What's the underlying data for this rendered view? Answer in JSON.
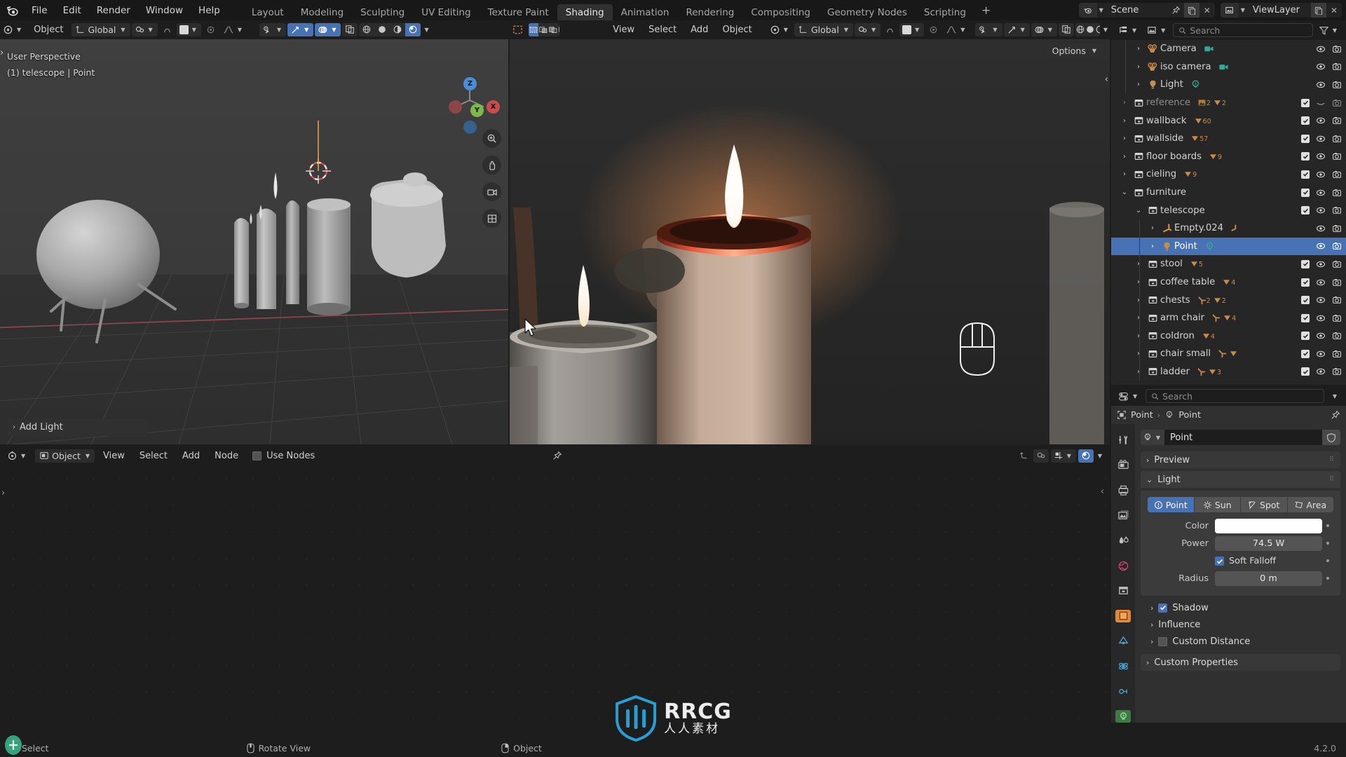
{
  "app": {
    "name": "Blender",
    "version": "4.2.0"
  },
  "topbar": {
    "menus": [
      "File",
      "Edit",
      "Render",
      "Window",
      "Help"
    ],
    "workspace_tabs": [
      {
        "label": "Layout",
        "active": false
      },
      {
        "label": "Modeling",
        "active": false
      },
      {
        "label": "Sculpting",
        "active": false
      },
      {
        "label": "UV Editing",
        "active": false
      },
      {
        "label": "Texture Paint",
        "active": false
      },
      {
        "label": "Shading",
        "active": true
      },
      {
        "label": "Animation",
        "active": false
      },
      {
        "label": "Rendering",
        "active": false
      },
      {
        "label": "Compositing",
        "active": false
      },
      {
        "label": "Geometry Nodes",
        "active": false
      },
      {
        "label": "Scripting",
        "active": false
      }
    ],
    "add_workspace": "+",
    "scene_name": "Scene",
    "viewlayer_name": "ViewLayer"
  },
  "viewport_left": {
    "mode": "Object",
    "transform_orientation": "Global",
    "overlay_text_line1": "User Perspective",
    "overlay_text_line2": "(1) telescope | Point",
    "operator_panel": "Add Light",
    "gizmo_axes": [
      "Z",
      "Y",
      "X"
    ]
  },
  "viewport_right": {
    "menus": [
      "View",
      "Select",
      "Add",
      "Object"
    ],
    "mode": "Object",
    "transform_orientation": "Global",
    "options_label": "Options"
  },
  "node_editor": {
    "mode": "Object",
    "menus": [
      "View",
      "Select",
      "Add",
      "Node"
    ],
    "use_nodes_label": "Use Nodes"
  },
  "outliner": {
    "search_placeholder": "Search",
    "items": [
      {
        "name": "Camera",
        "indent": 1,
        "icon": "camera-icon",
        "disclosure": "closed",
        "dim": false,
        "selected": false,
        "badges": [
          {
            "type": "camera-data",
            "count": ""
          }
        ],
        "checkbox": false,
        "eye": "open",
        "render": true
      },
      {
        "name": "iso camera",
        "indent": 1,
        "icon": "camera-icon",
        "disclosure": "closed",
        "dim": false,
        "selected": false,
        "badges": [
          {
            "type": "camera-data",
            "count": ""
          }
        ],
        "checkbox": false,
        "eye": "open",
        "render": true
      },
      {
        "name": "Light",
        "indent": 1,
        "icon": "light-icon",
        "disclosure": "closed",
        "dim": false,
        "selected": false,
        "badges": [
          {
            "type": "light-data",
            "count": ""
          }
        ],
        "checkbox": false,
        "eye": "open",
        "render": true
      },
      {
        "name": "reference",
        "indent": 0,
        "icon": "collection-icon",
        "disclosure": "closed",
        "dim": true,
        "selected": false,
        "badges": [
          {
            "type": "image",
            "count": "2"
          },
          {
            "type": "mesh",
            "count": "2"
          }
        ],
        "checkbox": true,
        "eye": "closed",
        "render": true
      },
      {
        "name": "wallback",
        "indent": 0,
        "icon": "collection-icon",
        "disclosure": "closed",
        "dim": false,
        "selected": false,
        "badges": [
          {
            "type": "mesh",
            "count": "60"
          }
        ],
        "checkbox": true,
        "eye": "open",
        "render": true
      },
      {
        "name": "wallside",
        "indent": 0,
        "icon": "collection-icon",
        "disclosure": "closed",
        "dim": false,
        "selected": false,
        "badges": [
          {
            "type": "mesh",
            "count": "57"
          }
        ],
        "checkbox": true,
        "eye": "open",
        "render": true
      },
      {
        "name": "floor boards",
        "indent": 0,
        "icon": "collection-icon",
        "disclosure": "closed",
        "dim": false,
        "selected": false,
        "badges": [
          {
            "type": "mesh",
            "count": "9"
          }
        ],
        "checkbox": true,
        "eye": "open",
        "render": true
      },
      {
        "name": "cieling",
        "indent": 0,
        "icon": "collection-icon",
        "disclosure": "closed",
        "dim": false,
        "selected": false,
        "badges": [
          {
            "type": "mesh",
            "count": "9"
          }
        ],
        "checkbox": true,
        "eye": "open",
        "render": true
      },
      {
        "name": "furniture",
        "indent": 0,
        "icon": "collection-icon",
        "disclosure": "open",
        "dim": false,
        "selected": false,
        "badges": [],
        "checkbox": true,
        "eye": "open",
        "render": true
      },
      {
        "name": "telescope",
        "indent": 1,
        "icon": "collection-icon",
        "disclosure": "open",
        "dim": false,
        "selected": false,
        "badges": [],
        "checkbox": true,
        "eye": "open",
        "render": true
      },
      {
        "name": "Empty.024",
        "indent": 2,
        "icon": "empty-icon",
        "disclosure": "closed",
        "dim": false,
        "selected": false,
        "badges": [
          {
            "type": "empty-data",
            "count": ""
          }
        ],
        "checkbox": false,
        "eye": "open",
        "render": true
      },
      {
        "name": "Point",
        "indent": 2,
        "icon": "light-icon",
        "disclosure": "closed",
        "dim": false,
        "selected": true,
        "badges": [
          {
            "type": "light-data",
            "count": ""
          }
        ],
        "checkbox": false,
        "eye": "open",
        "render": true
      },
      {
        "name": "stool",
        "indent": 1,
        "icon": "collection-icon",
        "disclosure": "closed",
        "dim": false,
        "selected": false,
        "badges": [
          {
            "type": "mesh",
            "count": "5"
          }
        ],
        "checkbox": true,
        "eye": "open",
        "render": true
      },
      {
        "name": "coffee table",
        "indent": 1,
        "icon": "collection-icon",
        "disclosure": "closed",
        "dim": false,
        "selected": false,
        "badges": [
          {
            "type": "mesh",
            "count": "4"
          }
        ],
        "checkbox": true,
        "eye": "open",
        "render": true
      },
      {
        "name": "chests",
        "indent": 1,
        "icon": "collection-icon",
        "disclosure": "closed",
        "dim": false,
        "selected": false,
        "badges": [
          {
            "type": "empty",
            "count": "2"
          },
          {
            "type": "mesh",
            "count": "2"
          }
        ],
        "checkbox": true,
        "eye": "open",
        "render": true
      },
      {
        "name": "arm chair",
        "indent": 1,
        "icon": "collection-icon",
        "disclosure": "closed",
        "dim": false,
        "selected": false,
        "badges": [
          {
            "type": "empty",
            "count": ""
          },
          {
            "type": "mesh",
            "count": "4"
          }
        ],
        "checkbox": true,
        "eye": "open",
        "render": true
      },
      {
        "name": "coldron",
        "indent": 1,
        "icon": "collection-icon",
        "disclosure": "closed",
        "dim": false,
        "selected": false,
        "badges": [
          {
            "type": "mesh",
            "count": "4"
          }
        ],
        "checkbox": true,
        "eye": "open",
        "render": true
      },
      {
        "name": "chair small",
        "indent": 1,
        "icon": "collection-icon",
        "disclosure": "closed",
        "dim": false,
        "selected": false,
        "badges": [
          {
            "type": "empty",
            "count": ""
          },
          {
            "type": "mesh",
            "count": ""
          }
        ],
        "checkbox": true,
        "eye": "open",
        "render": true
      },
      {
        "name": "ladder",
        "indent": 1,
        "icon": "collection-icon",
        "disclosure": "closed",
        "dim": false,
        "selected": false,
        "badges": [
          {
            "type": "empty",
            "count": ""
          },
          {
            "type": "mesh",
            "count": "3"
          }
        ],
        "checkbox": true,
        "eye": "open",
        "render": true
      }
    ]
  },
  "properties": {
    "search_placeholder": "Search",
    "breadcrumb": [
      "Point",
      "Point"
    ],
    "datablock_name": "Point",
    "panels": {
      "preview": {
        "label": "Preview",
        "open": false
      },
      "light": {
        "label": "Light",
        "open": true
      },
      "shadow": {
        "label": "Shadow",
        "open": false,
        "checked": true
      },
      "influence": {
        "label": "Influence",
        "open": false
      },
      "custom_distance": {
        "label": "Custom Distance",
        "open": false,
        "checked": false
      },
      "custom_properties": {
        "label": "Custom Properties",
        "open": false
      }
    },
    "light_types": [
      {
        "label": "Point",
        "active": true
      },
      {
        "label": "Sun",
        "active": false
      },
      {
        "label": "Spot",
        "active": false
      },
      {
        "label": "Area",
        "active": false
      }
    ],
    "fields": {
      "color_label": "Color",
      "color_value": "#ffffff",
      "power_label": "Power",
      "power_value": "74.5 W",
      "soft_falloff_label": "Soft Falloff",
      "soft_falloff_checked": true,
      "radius_label": "Radius",
      "radius_value": "0 m"
    }
  },
  "statusbar": {
    "entries": [
      {
        "icon": "mouse-left-icon",
        "label": "Select"
      },
      {
        "icon": "mouse-middle-icon",
        "label": "Rotate View"
      },
      {
        "icon": "mouse-right-icon",
        "label": "Object"
      }
    ],
    "version": "4.2.0"
  },
  "watermark": {
    "line1": "RRCG",
    "line2": "人人素材"
  },
  "colors": {
    "accent_blue": "#4772b3",
    "outliner_bg": "#262626",
    "properties_bg": "#303030",
    "header_bg": "#1d1d1d",
    "orange": "#c98b4b"
  }
}
